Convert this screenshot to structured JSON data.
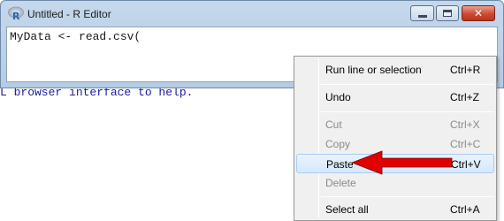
{
  "console": {
    "text": "L browser interface to help."
  },
  "editor": {
    "title": "Untitled - R Editor",
    "app_icon": "r-logo-icon",
    "code": "MyData <- read.csv(",
    "buttons": {
      "minimize": "minimize-icon",
      "maximize": "maximize-icon",
      "close_glyph": "✕"
    }
  },
  "context_menu": {
    "items": [
      {
        "label": "Run line or selection",
        "shortcut": "Ctrl+R",
        "state": "enabled"
      },
      {
        "label": "Undo",
        "shortcut": "Ctrl+Z",
        "state": "enabled"
      },
      {
        "label": "Cut",
        "shortcut": "Ctrl+X",
        "state": "disabled"
      },
      {
        "label": "Copy",
        "shortcut": "Ctrl+C",
        "state": "disabled"
      },
      {
        "label": "Paste",
        "shortcut": "Ctrl+V",
        "state": "highlighted"
      },
      {
        "label": "Delete",
        "shortcut": "",
        "state": "disabled"
      },
      {
        "label": "Select all",
        "shortcut": "Ctrl+A",
        "state": "enabled"
      }
    ]
  },
  "annotation": {
    "arrow_color": "#e00000",
    "target": "Paste"
  }
}
